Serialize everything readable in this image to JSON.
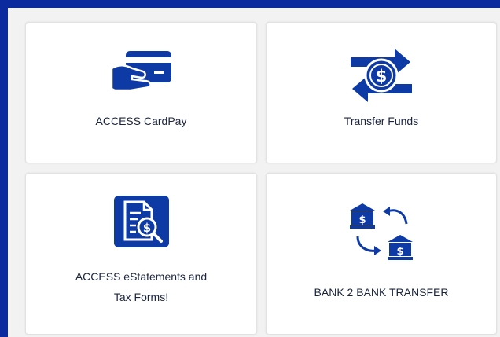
{
  "tiles": [
    {
      "label": "ACCESS CardPay",
      "icon": "card-pay-icon"
    },
    {
      "label": "Transfer Funds",
      "icon": "transfer-funds-icon"
    },
    {
      "label_lines": [
        "ACCESS eStatements and",
        "Tax Forms!"
      ],
      "icon": "estatement-icon"
    },
    {
      "label": "BANK 2 BANK TRANSFER",
      "icon": "bank-transfer-icon"
    }
  ],
  "colors": {
    "border": "#0b2a9e",
    "icon": "#0e3aa6",
    "text": "#1a2440",
    "tile_bg": "#ffffff"
  }
}
